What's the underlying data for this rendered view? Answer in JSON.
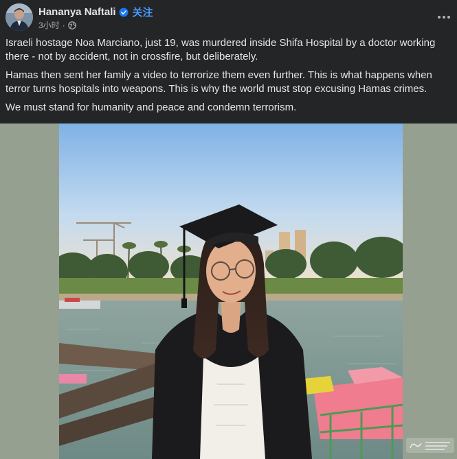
{
  "post": {
    "author": "Hananya Naftali",
    "follow_label": "关注",
    "timestamp": "3小时",
    "privacy_icon": "globe-icon",
    "more_icon": "more-horizontal-icon",
    "paragraphs": [
      "Israeli hostage Noa Marciano, just 19, was murdered inside Shifa Hospital by a doctor working there - not by accident, not in crossfire, but deliberately.",
      "Hamas then sent her family a video to terrorize them even further. This is what happens when terror turns hospitals into weapons. This is why the world must stop excusing Hamas crimes.",
      "We must stand for humanity and peace and condemn terrorism."
    ]
  },
  "colors": {
    "background": "#242526",
    "text": "#e4e6eb",
    "secondary_text": "#b0b3b8",
    "link": "#4599ff",
    "verified": "#1877f2",
    "photo_backdrop": "#96a091"
  }
}
